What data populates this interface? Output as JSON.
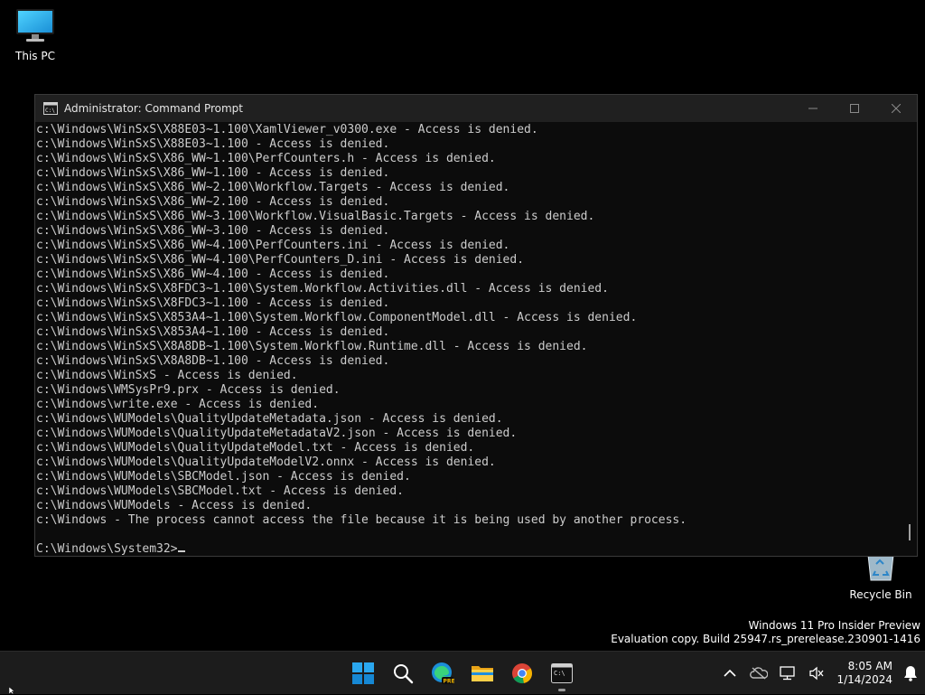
{
  "desktop": {
    "icons": [
      {
        "label": "This PC",
        "icon": "monitor-icon"
      },
      {
        "label": "Recycle Bin",
        "icon": "recycle-bin-icon"
      }
    ],
    "watermark": {
      "line1": "Windows 11 Pro Insider Preview",
      "line2": "Evaluation copy. Build 25947.rs_prerelease.230901-1416"
    }
  },
  "window": {
    "title": "Administrator: Command Prompt",
    "icon": "cmd-icon",
    "controls": [
      "minimize-icon",
      "maximize-icon",
      "close-icon"
    ]
  },
  "console": {
    "lines": [
      "c:\\Windows\\WinSxS\\X88E03~1.100\\XamlViewer_v0300.exe - Access is denied.",
      "c:\\Windows\\WinSxS\\X88E03~1.100 - Access is denied.",
      "c:\\Windows\\WinSxS\\X86_WW~1.100\\PerfCounters.h - Access is denied.",
      "c:\\Windows\\WinSxS\\X86_WW~1.100 - Access is denied.",
      "c:\\Windows\\WinSxS\\X86_WW~2.100\\Workflow.Targets - Access is denied.",
      "c:\\Windows\\WinSxS\\X86_WW~2.100 - Access is denied.",
      "c:\\Windows\\WinSxS\\X86_WW~3.100\\Workflow.VisualBasic.Targets - Access is denied.",
      "c:\\Windows\\WinSxS\\X86_WW~3.100 - Access is denied.",
      "c:\\Windows\\WinSxS\\X86_WW~4.100\\PerfCounters.ini - Access is denied.",
      "c:\\Windows\\WinSxS\\X86_WW~4.100\\PerfCounters_D.ini - Access is denied.",
      "c:\\Windows\\WinSxS\\X86_WW~4.100 - Access is denied.",
      "c:\\Windows\\WinSxS\\X8FDC3~1.100\\System.Workflow.Activities.dll - Access is denied.",
      "c:\\Windows\\WinSxS\\X8FDC3~1.100 - Access is denied.",
      "c:\\Windows\\WinSxS\\X853A4~1.100\\System.Workflow.ComponentModel.dll - Access is denied.",
      "c:\\Windows\\WinSxS\\X853A4~1.100 - Access is denied.",
      "c:\\Windows\\WinSxS\\X8A8DB~1.100\\System.Workflow.Runtime.dll - Access is denied.",
      "c:\\Windows\\WinSxS\\X8A8DB~1.100 - Access is denied.",
      "c:\\Windows\\WinSxS - Access is denied.",
      "c:\\Windows\\WMSysPr9.prx - Access is denied.",
      "c:\\Windows\\write.exe - Access is denied.",
      "c:\\Windows\\WUModels\\QualityUpdateMetadata.json - Access is denied.",
      "c:\\Windows\\WUModels\\QualityUpdateMetadataV2.json - Access is denied.",
      "c:\\Windows\\WUModels\\QualityUpdateModel.txt - Access is denied.",
      "c:\\Windows\\WUModels\\QualityUpdateModelV2.onnx - Access is denied.",
      "c:\\Windows\\WUModels\\SBCModel.json - Access is denied.",
      "c:\\Windows\\WUModels\\SBCModel.txt - Access is denied.",
      "c:\\Windows\\WUModels - Access is denied.",
      "c:\\Windows - The process cannot access the file because it is being used by another process.",
      ""
    ],
    "prompt": "C:\\Windows\\System32>"
  },
  "taskbar": {
    "apps": [
      {
        "name": "start-button",
        "icon": "windows-logo-icon"
      },
      {
        "name": "search-button",
        "icon": "search-icon"
      },
      {
        "name": "edge-button",
        "icon": "edge-icon"
      },
      {
        "name": "file-explorer-button",
        "icon": "folder-icon"
      },
      {
        "name": "chrome-button",
        "icon": "chrome-icon"
      },
      {
        "name": "terminal-button",
        "icon": "terminal-icon"
      }
    ],
    "tray": [
      "chevron-up-icon",
      "onedrive-icon",
      "network-icon",
      "volume-icon",
      "notification-bell-icon"
    ],
    "time": "8:05 AM",
    "date": "1/14/2024"
  },
  "colors": {
    "console_bg": "#0c0c0c",
    "console_text": "#cccccc",
    "titlebar_bg": "#202020",
    "taskbar_bg": "#1c1c1c",
    "accent": "#0078d4"
  }
}
